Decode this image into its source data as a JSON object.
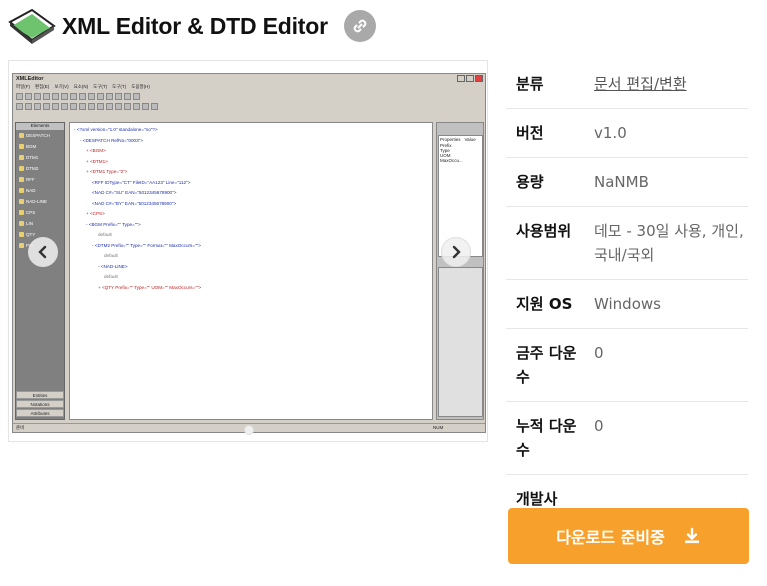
{
  "header": {
    "title": "XML Editor & DTD Editor"
  },
  "screenshot": {
    "window_title": "XMLEditor",
    "menu": [
      "파일(F)",
      "편집(E)",
      "보기(V)",
      "요소(N)",
      "도구(T)",
      "도구(T)",
      "도움말(H)"
    ],
    "left_panel": {
      "head": "Elements",
      "items": [
        "DESPATCH",
        "BGM",
        "DTM1",
        "DTM2",
        "RFF",
        "NAD",
        "NAD-LINE",
        "CPS",
        "LIN",
        "QTY",
        "PCI"
      ],
      "footers": [
        "Entities",
        "Notations",
        "Attributes"
      ]
    },
    "xml_lines": [
      {
        "i": 0,
        "t": "- <?xml version=\"1.0\" standalone=\"no\"?>"
      },
      {
        "i": 1,
        "t": "- <DESPATCH RefNo=\"0003\">"
      },
      {
        "i": 2,
        "t": "+ <BGM>"
      },
      {
        "i": 2,
        "t": "+ <DTM1>"
      },
      {
        "i": 2,
        "t": "+ <DTM1 Type=\"2\">"
      },
      {
        "i": 3,
        "t": "<RFF IDType=\"CT\" FileID=\"AA123\" Line=\"112\">"
      },
      {
        "i": 3,
        "t": "<NAD C#=\"SU\" EAN=\"5012345678900\">"
      },
      {
        "i": 3,
        "t": "<NAD C#=\"BY\" EAN=\"5012345678900\">"
      },
      {
        "i": 2,
        "t": "+ <CPS>"
      },
      {
        "i": 2,
        "t": "- <BGM Prefix=\"\" Type=\"\">"
      },
      {
        "i": 4,
        "t": "default"
      },
      {
        "i": 3,
        "t": "- <DTM2 Prefix=\"\" Type=\"\" Format=\"\" MaxOccurs=\"\">"
      },
      {
        "i": 5,
        "t": "default"
      },
      {
        "i": 4,
        "t": "- <NAD-LINE>"
      },
      {
        "i": 5,
        "t": "default"
      },
      {
        "i": 4,
        "t": "+ <QTY Prefix=\"\" Type=\"\" UOM=\"\" MaxOccurs=\"\">"
      }
    ],
    "right_panel": {
      "headers": [
        "Properties",
        "Value"
      ],
      "items": [
        "Prefix",
        "Type",
        "UOM",
        "MaxOccu..."
      ]
    },
    "status_left": "준비",
    "status_right": "NUM"
  },
  "info": {
    "rows": [
      {
        "key": "분류",
        "value": "문서 편집/변환",
        "link": true
      },
      {
        "key": "버전",
        "value": "v1.0"
      },
      {
        "key": "용량",
        "value": "NaNMB"
      },
      {
        "key": "사용범위",
        "value": "데모 - 30일 사용, 개인, 국내/국외"
      },
      {
        "key": "지원 OS",
        "value": "Windows"
      },
      {
        "key": "금주 다운수",
        "value": "0"
      },
      {
        "key": "누적 다운수",
        "value": "0"
      },
      {
        "key": "개발사",
        "value": ""
      }
    ]
  },
  "download": {
    "label": "다운로드 준비중"
  },
  "colors": {
    "accent": "#f7a12c",
    "link_btn": "#a9a9a9"
  },
  "icons": [
    "app-icon",
    "link-icon",
    "chevron-left-icon",
    "chevron-right-icon",
    "download-icon"
  ]
}
